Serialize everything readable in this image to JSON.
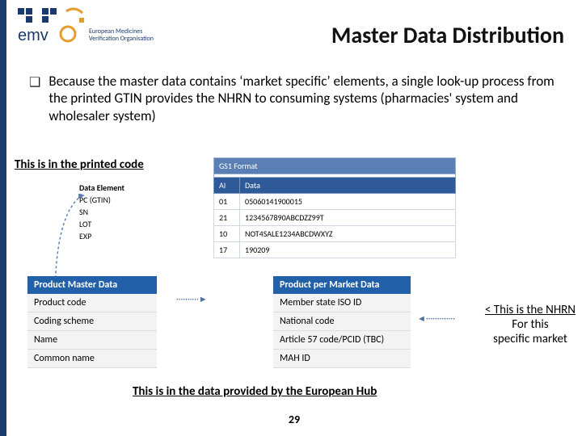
{
  "logo": {
    "line1": "European Medicines",
    "line2": "Verification Organisation"
  },
  "title": "Master Data Distribution",
  "bullet_text": "Because the master data contains ‘market specific’ elements, a single look-up process from the printed GTIN provides the NHRN to consuming systems (pharmacies' system and wholesaler system)",
  "printed_label": "This is in the printed code",
  "gs1": {
    "format_header": "GS1 Format",
    "cols": {
      "ai": "AI",
      "data": "Data"
    },
    "rows": [
      {
        "ai": "01",
        "data": "05060141900015"
      },
      {
        "ai": "21",
        "data": "1234567890ABCDZZ99T"
      },
      {
        "ai": "10",
        "data": "NOT4SALE1234ABCDWXYZ"
      },
      {
        "ai": "17",
        "data": "190209"
      }
    ]
  },
  "data_elements": {
    "header": "Data Element",
    "rows": [
      "PC (GTIN)",
      "SN",
      "LOT",
      "EXP"
    ]
  },
  "master": {
    "header": "Product Master Data",
    "rows": [
      "Product code",
      "Coding scheme",
      "Name",
      "Common name"
    ]
  },
  "market": {
    "header": "Product per Market Data",
    "rows": [
      "Member state ISO ID",
      "National code",
      "Article 57 code/PCID (TBC)",
      "MAH ID"
    ]
  },
  "nhrn": {
    "line1": "< This is the NHRN",
    "line2": "For this",
    "line3": "specific market"
  },
  "hub_label": "This is in the data provided by the European Hub",
  "page_number": "29"
}
